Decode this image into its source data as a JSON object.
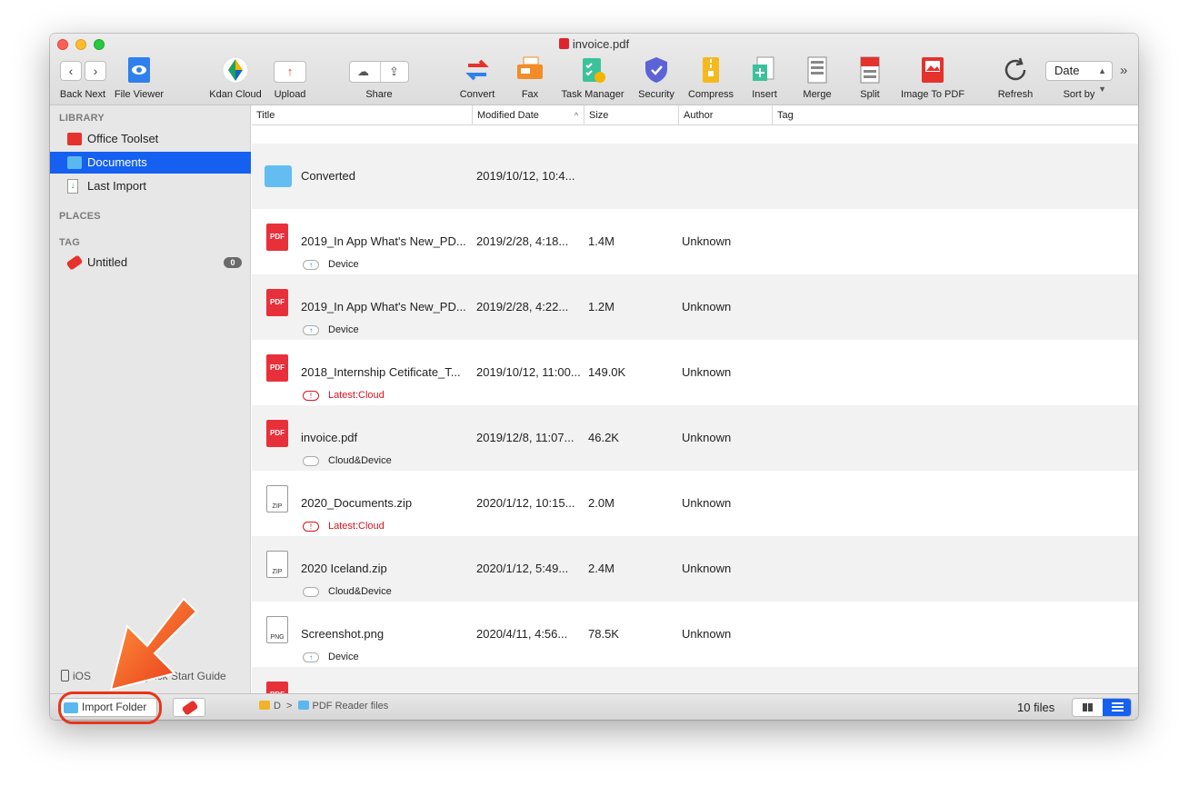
{
  "window": {
    "title": "invoice.pdf"
  },
  "toolbar": {
    "back_next_label": "Back Next",
    "items": [
      {
        "label": "File Viewer",
        "icon": "eye-icon"
      },
      {
        "label": "Kdan Cloud",
        "icon": "kdan-cloud-icon"
      },
      {
        "label": "Upload",
        "icon": "upload-icon"
      },
      {
        "label": "Share",
        "icon": "share-icon"
      },
      {
        "label": "Convert",
        "icon": "convert-icon"
      },
      {
        "label": "Fax",
        "icon": "fax-icon"
      },
      {
        "label": "Task Manager",
        "icon": "task-manager-icon"
      },
      {
        "label": "Security",
        "icon": "shield-icon"
      },
      {
        "label": "Compress",
        "icon": "compress-icon"
      },
      {
        "label": "Insert",
        "icon": "insert-icon"
      },
      {
        "label": "Merge",
        "icon": "merge-icon"
      },
      {
        "label": "Split",
        "icon": "split-icon"
      },
      {
        "label": "Image To PDF",
        "icon": "image-to-pdf-icon"
      },
      {
        "label": "Refresh",
        "icon": "refresh-icon"
      }
    ],
    "sort": {
      "label": "Sort by",
      "value": "Date"
    },
    "overflow": "»"
  },
  "sidebar": {
    "library_heading": "LIBRARY",
    "library": [
      {
        "label": "Office Toolset"
      },
      {
        "label": "Documents"
      },
      {
        "label": "Last Import"
      }
    ],
    "places_heading": "PLACES",
    "tag_heading": "TAG",
    "tags": [
      {
        "label": "Untitled",
        "count": "0"
      }
    ],
    "ios_label": "iOS",
    "quick_start_label": "Quick Start Guide"
  },
  "list": {
    "columns": [
      "Title",
      "Modified Date",
      "Size",
      "Author",
      "Tag"
    ],
    "sort_indicator": "^",
    "rows": [
      {
        "title": "Converted",
        "date": "2019/10/12, 10:4...",
        "size": "",
        "author": "",
        "status": "",
        "kind": "folder"
      },
      {
        "title": "2019_In App What's New_PD...",
        "date": "2019/2/28, 4:18...",
        "size": "1.4M",
        "author": "Unknown",
        "status": "Device",
        "kind": "pdf"
      },
      {
        "title": "2019_In App What's New_PD...",
        "date": "2019/2/28, 4:22...",
        "size": "1.2M",
        "author": "Unknown",
        "status": "Device",
        "kind": "pdf"
      },
      {
        "title": "2018_Internship Cetificate_T...",
        "date": "2019/10/12, 11:00...",
        "size": "149.0K",
        "author": "Unknown",
        "status": "Latest:Cloud",
        "kind": "pdf"
      },
      {
        "title": "invoice.pdf",
        "date": "2019/12/8, 11:07...",
        "size": "46.2K",
        "author": "Unknown",
        "status": "Cloud&Device",
        "kind": "pdf"
      },
      {
        "title": "2020_Documents.zip",
        "date": "2020/1/12, 10:15...",
        "size": "2.0M",
        "author": "Unknown",
        "status": "Latest:Cloud",
        "kind": "zip"
      },
      {
        "title": "2020 Iceland.zip",
        "date": "2020/1/12, 5:49...",
        "size": "2.4M",
        "author": "Unknown",
        "status": "Cloud&Device",
        "kind": "zip"
      },
      {
        "title": "Screenshot.png",
        "date": "2020/4/11, 4:56...",
        "size": "78.5K",
        "author": "Unknown",
        "status": "Device",
        "kind": "png"
      }
    ]
  },
  "bottom": {
    "import_folder_label": "Import Folder",
    "breadcrumb_root": "D",
    "breadcrumb_sep": ">",
    "breadcrumb_folder": "PDF Reader files",
    "file_count": "10 files"
  },
  "file_badges": {
    "pdf": "PDF",
    "zip": "ZIP",
    "png": "PNG"
  },
  "status_glyphs": {
    "device": "↑",
    "alert": "!"
  },
  "colors": {
    "accent": "#1560f0",
    "alert": "#d8121c",
    "annotation": "#e8341a"
  }
}
